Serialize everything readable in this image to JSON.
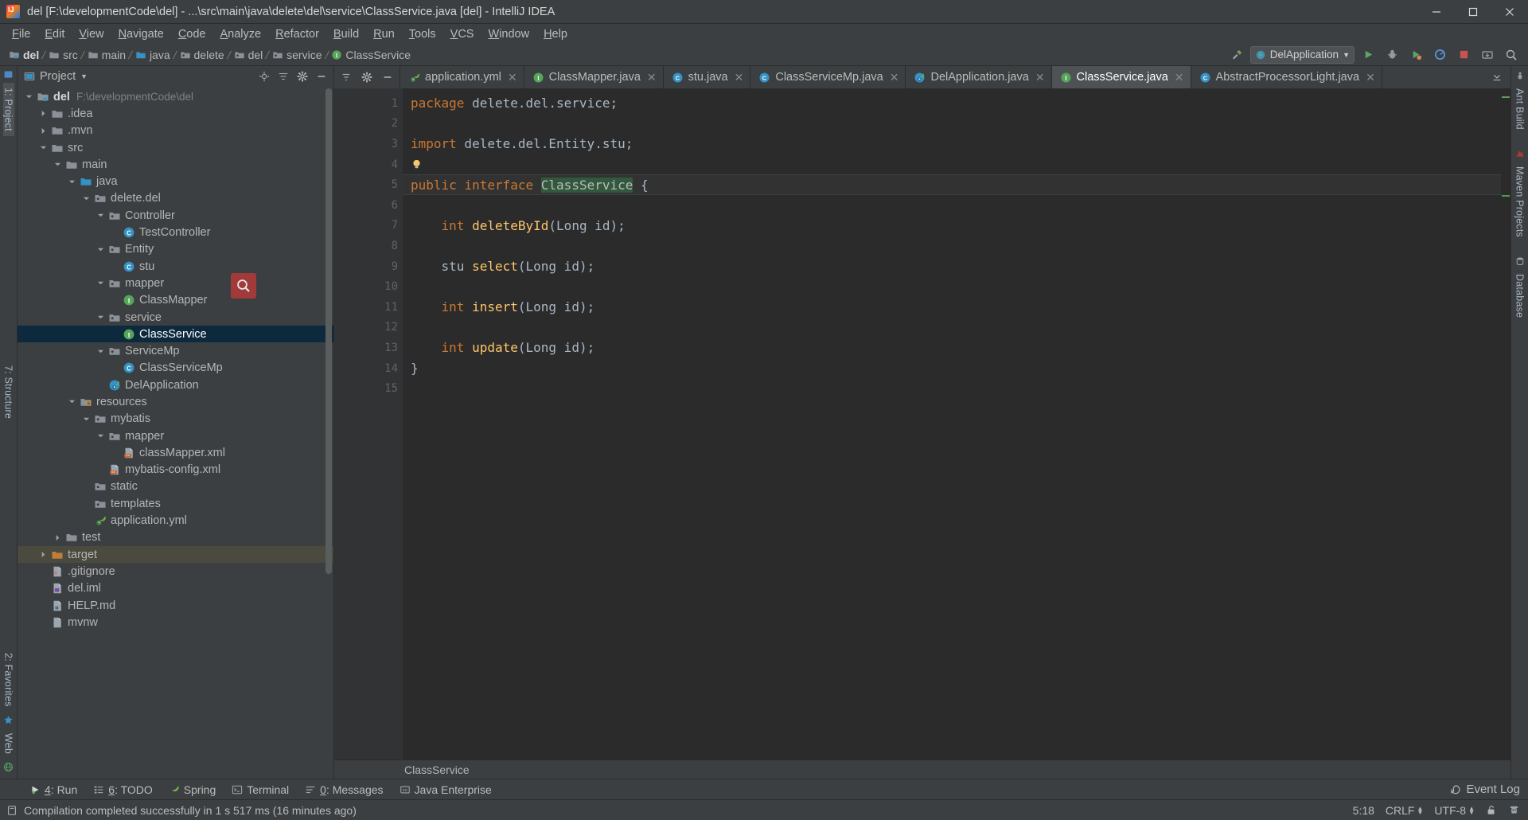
{
  "window": {
    "title": "del [F:\\developmentCode\\del] - ...\\src\\main\\java\\delete\\del\\service\\ClassService.java [del] - IntelliJ IDEA",
    "app_icon": "intellij-idea-icon",
    "minimize": "–",
    "maximize": "☐",
    "close": "✕"
  },
  "menubar": {
    "items": [
      {
        "label": "File"
      },
      {
        "label": "Edit"
      },
      {
        "label": "View"
      },
      {
        "label": "Navigate"
      },
      {
        "label": "Code"
      },
      {
        "label": "Analyze"
      },
      {
        "label": "Refactor"
      },
      {
        "label": "Build"
      },
      {
        "label": "Run"
      },
      {
        "label": "Tools"
      },
      {
        "label": "VCS"
      },
      {
        "label": "Window"
      },
      {
        "label": "Help"
      }
    ]
  },
  "navbar": {
    "breadcrumbs": [
      {
        "label": "del",
        "icon": "module-icon",
        "bold": true
      },
      {
        "label": "src",
        "icon": "folder-icon",
        "bold": false
      },
      {
        "label": "main",
        "icon": "folder-icon",
        "bold": false
      },
      {
        "label": "java",
        "icon": "source-folder-icon",
        "bold": false
      },
      {
        "label": "delete",
        "icon": "package-icon",
        "bold": false
      },
      {
        "label": "del",
        "icon": "package-icon",
        "bold": false
      },
      {
        "label": "service",
        "icon": "package-icon",
        "bold": false
      },
      {
        "label": "ClassService",
        "icon": "interface-icon",
        "bold": false
      }
    ],
    "run_config": "DelApplication",
    "actions": [
      "hammer-build-icon",
      "run-icon",
      "debug-icon",
      "run-coverage-icon",
      "profile-icon",
      "stop-icon",
      "update-project-icon",
      "search-everywhere-icon"
    ]
  },
  "left_rail": {
    "top": [
      {
        "label": "1: Project",
        "selected": true
      }
    ],
    "middle": [
      {
        "label": "7: Structure",
        "selected": false
      }
    ],
    "bottom": [
      {
        "label": "2: Favorites",
        "selected": false
      },
      {
        "label": "Web",
        "selected": false
      }
    ]
  },
  "right_rail": {
    "items": [
      {
        "label": "Ant Build"
      },
      {
        "label": "Maven Projects"
      },
      {
        "label": "Database"
      }
    ]
  },
  "project_panel": {
    "title": "Project",
    "title_icon": "project-view-icon",
    "dropdown_icon": "chevron-down-icon",
    "actions": [
      "collapse-all-icon",
      "locate-icon",
      "settings-gear-icon",
      "hide-icon"
    ],
    "tree": [
      {
        "depth": 0,
        "label": "del",
        "path": "F:\\developmentCode\\del",
        "icon": "module-icon",
        "arrow": "down",
        "bold": true,
        "state": "normal"
      },
      {
        "depth": 1,
        "label": ".idea",
        "icon": "folder-icon",
        "arrow": "right",
        "state": "normal"
      },
      {
        "depth": 1,
        "label": ".mvn",
        "icon": "folder-icon",
        "arrow": "right",
        "state": "normal"
      },
      {
        "depth": 1,
        "label": "src",
        "icon": "folder-icon",
        "arrow": "down",
        "state": "normal"
      },
      {
        "depth": 2,
        "label": "main",
        "icon": "folder-icon",
        "arrow": "down",
        "state": "normal"
      },
      {
        "depth": 3,
        "label": "java",
        "icon": "source-folder-icon",
        "arrow": "down",
        "state": "normal"
      },
      {
        "depth": 4,
        "label": "delete.del",
        "icon": "package-icon",
        "arrow": "down",
        "state": "normal"
      },
      {
        "depth": 5,
        "label": "Controller",
        "icon": "package-icon",
        "arrow": "down",
        "state": "normal"
      },
      {
        "depth": 6,
        "label": "TestController",
        "icon": "class-icon",
        "arrow": "none",
        "state": "normal"
      },
      {
        "depth": 5,
        "label": "Entity",
        "icon": "package-icon",
        "arrow": "down",
        "state": "normal"
      },
      {
        "depth": 6,
        "label": "stu",
        "icon": "class-icon",
        "arrow": "none",
        "state": "normal"
      },
      {
        "depth": 5,
        "label": "mapper",
        "icon": "package-icon",
        "arrow": "down",
        "state": "normal"
      },
      {
        "depth": 6,
        "label": "ClassMapper",
        "icon": "interface-icon",
        "arrow": "none",
        "state": "normal"
      },
      {
        "depth": 5,
        "label": "service",
        "icon": "package-icon",
        "arrow": "down",
        "state": "normal"
      },
      {
        "depth": 6,
        "label": "ClassService",
        "icon": "interface-icon",
        "arrow": "none",
        "state": "selected"
      },
      {
        "depth": 5,
        "label": "ServiceMp",
        "icon": "package-icon",
        "arrow": "down",
        "state": "normal"
      },
      {
        "depth": 6,
        "label": "ClassServiceMp",
        "icon": "class-icon",
        "arrow": "none",
        "state": "normal"
      },
      {
        "depth": 5,
        "label": "DelApplication",
        "icon": "spring-class-icon",
        "arrow": "none",
        "state": "normal"
      },
      {
        "depth": 3,
        "label": "resources",
        "icon": "resources-folder-icon",
        "arrow": "down",
        "state": "normal"
      },
      {
        "depth": 4,
        "label": "mybatis",
        "icon": "package-icon",
        "arrow": "down",
        "state": "normal"
      },
      {
        "depth": 5,
        "label": "mapper",
        "icon": "package-icon",
        "arrow": "down",
        "state": "normal"
      },
      {
        "depth": 6,
        "label": "classMapper.xml",
        "icon": "xml-file-icon",
        "arrow": "none",
        "state": "normal"
      },
      {
        "depth": 5,
        "label": "mybatis-config.xml",
        "icon": "xml-file-icon",
        "arrow": "none",
        "state": "normal"
      },
      {
        "depth": 4,
        "label": "static",
        "icon": "package-icon",
        "arrow": "none",
        "state": "normal"
      },
      {
        "depth": 4,
        "label": "templates",
        "icon": "package-icon",
        "arrow": "none",
        "state": "normal"
      },
      {
        "depth": 4,
        "label": "application.yml",
        "icon": "spring-yml-icon",
        "arrow": "none",
        "state": "normal"
      },
      {
        "depth": 2,
        "label": "test",
        "icon": "folder-icon",
        "arrow": "right",
        "state": "normal"
      },
      {
        "depth": 1,
        "label": "target",
        "icon": "target-folder-icon",
        "arrow": "right",
        "state": "highlight"
      },
      {
        "depth": 1,
        "label": ".gitignore",
        "icon": "gitignore-icon",
        "arrow": "none",
        "state": "normal"
      },
      {
        "depth": 1,
        "label": "del.iml",
        "icon": "iml-icon",
        "arrow": "none",
        "state": "normal"
      },
      {
        "depth": 1,
        "label": "HELP.md",
        "icon": "markdown-icon",
        "arrow": "none",
        "state": "normal"
      },
      {
        "depth": 1,
        "label": "mvnw",
        "icon": "file-icon",
        "arrow": "none",
        "state": "normal"
      }
    ],
    "cursor_icon": "search-magnifier-cursor"
  },
  "editor": {
    "tabs": [
      {
        "label": "application.yml",
        "icon": "spring-yml-icon",
        "active": false,
        "close": "✕"
      },
      {
        "label": "ClassMapper.java",
        "icon": "interface-icon",
        "active": false,
        "close": "✕"
      },
      {
        "label": "stu.java",
        "icon": "class-icon",
        "active": false,
        "close": "✕"
      },
      {
        "label": "ClassServiceMp.java",
        "icon": "class-icon",
        "active": false,
        "close": "✕"
      },
      {
        "label": "DelApplication.java",
        "icon": "spring-class-icon",
        "active": false,
        "close": "✕"
      },
      {
        "label": "ClassService.java",
        "icon": "interface-icon",
        "active": true,
        "close": "✕"
      },
      {
        "label": "AbstractProcessorLight.java",
        "icon": "class-icon",
        "active": false,
        "close": "✕"
      }
    ],
    "lines": [
      {
        "n": 1,
        "marks": [],
        "tokens": [
          {
            "t": "package",
            "c": "kw"
          },
          {
            "t": " delete.",
            "c": "pl"
          },
          {
            "t": "del.",
            "c": "pl"
          },
          {
            "t": "service;",
            "c": "pl"
          }
        ]
      },
      {
        "n": 2,
        "marks": [],
        "tokens": []
      },
      {
        "n": 3,
        "marks": [],
        "tokens": [
          {
            "t": "import",
            "c": "kw"
          },
          {
            "t": " delete.",
            "c": "pl"
          },
          {
            "t": "del.",
            "c": "pl"
          },
          {
            "t": "Entity.",
            "c": "pl"
          },
          {
            "t": "stu;",
            "c": "pl"
          }
        ]
      },
      {
        "n": 4,
        "marks": [
          "bulb"
        ],
        "tokens": []
      },
      {
        "n": 5,
        "marks": [
          "spring-bean",
          "interface-impl"
        ],
        "current": true,
        "tokens": [
          {
            "t": "public",
            "c": "kw"
          },
          {
            "t": " ",
            "c": "pl"
          },
          {
            "t": "interface",
            "c": "kw"
          },
          {
            "t": " ",
            "c": "pl"
          },
          {
            "t": "ClassService",
            "c": "hl"
          },
          {
            "t": " {",
            "c": "pl"
          }
        ]
      },
      {
        "n": 6,
        "marks": [],
        "tokens": []
      },
      {
        "n": 7,
        "marks": [
          "interface-impl"
        ],
        "tokens": [
          {
            "t": "    ",
            "c": "pl"
          },
          {
            "t": "int",
            "c": "kw"
          },
          {
            "t": " ",
            "c": "pl"
          },
          {
            "t": "deleteById",
            "c": "id"
          },
          {
            "t": "(",
            "c": "pl"
          },
          {
            "t": "Long",
            "c": "tp"
          },
          {
            "t": " id);",
            "c": "pl"
          }
        ]
      },
      {
        "n": 8,
        "marks": [],
        "tokens": []
      },
      {
        "n": 9,
        "marks": [
          "interface-impl"
        ],
        "tokens": [
          {
            "t": "    ",
            "c": "pl"
          },
          {
            "t": "stu",
            "c": "tp"
          },
          {
            "t": " ",
            "c": "pl"
          },
          {
            "t": "select",
            "c": "id"
          },
          {
            "t": "(",
            "c": "pl"
          },
          {
            "t": "Long",
            "c": "tp"
          },
          {
            "t": " id);",
            "c": "pl"
          }
        ]
      },
      {
        "n": 10,
        "marks": [],
        "tokens": []
      },
      {
        "n": 11,
        "marks": [
          "interface-impl"
        ],
        "tokens": [
          {
            "t": "    ",
            "c": "pl"
          },
          {
            "t": "int",
            "c": "kw"
          },
          {
            "t": " ",
            "c": "pl"
          },
          {
            "t": "insert",
            "c": "id"
          },
          {
            "t": "(",
            "c": "pl"
          },
          {
            "t": "Long",
            "c": "tp"
          },
          {
            "t": " id);",
            "c": "pl"
          }
        ]
      },
      {
        "n": 12,
        "marks": [],
        "tokens": []
      },
      {
        "n": 13,
        "marks": [
          "interface-impl"
        ],
        "tokens": [
          {
            "t": "    ",
            "c": "pl"
          },
          {
            "t": "int",
            "c": "kw"
          },
          {
            "t": " ",
            "c": "pl"
          },
          {
            "t": "update",
            "c": "id"
          },
          {
            "t": "(",
            "c": "pl"
          },
          {
            "t": "Long",
            "c": "tp"
          },
          {
            "t": " id);",
            "c": "pl"
          }
        ]
      },
      {
        "n": 14,
        "marks": [],
        "tokens": [
          {
            "t": "}",
            "c": "pl"
          }
        ]
      },
      {
        "n": 15,
        "marks": [],
        "tokens": []
      }
    ],
    "breadcrumb": "ClassService"
  },
  "bottom_bar": {
    "items": [
      {
        "label": "4: Run",
        "icon": "run-icon",
        "mnemonic": "4"
      },
      {
        "label": "6: TODO",
        "icon": "todo-icon",
        "mnemonic": "6"
      },
      {
        "label": "Spring",
        "icon": "spring-leaf-icon",
        "mnemonic": ""
      },
      {
        "label": "Terminal",
        "icon": "terminal-icon",
        "mnemonic": ""
      },
      {
        "label": "0: Messages",
        "icon": "messages-icon",
        "mnemonic": "0"
      },
      {
        "label": "Java Enterprise",
        "icon": "java-ee-icon",
        "mnemonic": ""
      }
    ],
    "event_log": "Event Log",
    "event_log_icon": "event-log-icon"
  },
  "statusbar": {
    "message": "Compilation completed successfully in 1 s 517 ms (16 minutes ago)",
    "message_icon": "build-status-icon",
    "caret_position": "5:18",
    "line_separator": "CRLF",
    "encoding": "UTF-8",
    "lock_icon": "unlocked-padlock-icon",
    "inspection_icon": "hector-inspector-icon"
  },
  "colors": {
    "bg_chrome": "#3c3f41",
    "bg_editor": "#2b2b2b",
    "bg_gutter": "#313335",
    "selection_blue": "#0d293e",
    "accent_orange": "#cc7832",
    "accent_yellow": "#ffc66d",
    "text": "#bbbbbb",
    "cursor_red": "#a33a3a",
    "highlight_green": "#32593d"
  }
}
